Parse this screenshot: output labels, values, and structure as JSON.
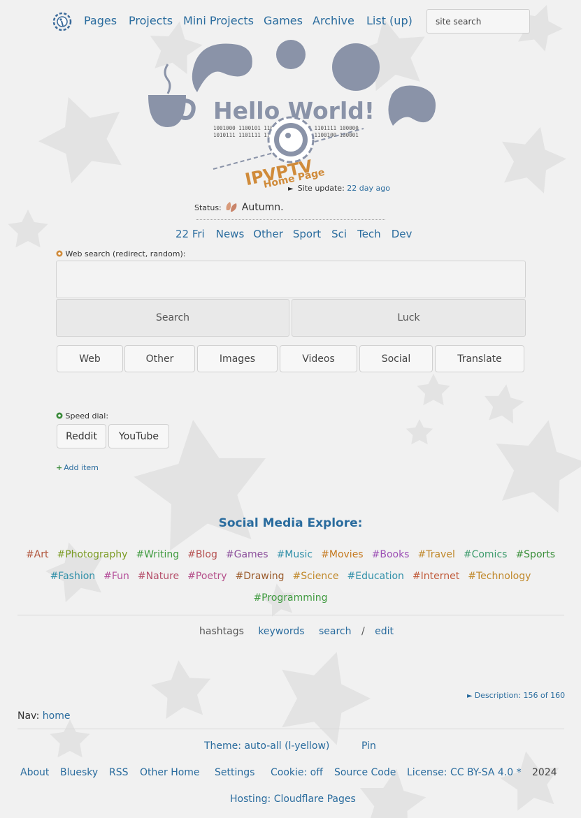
{
  "topnav": {
    "links": [
      "Pages",
      "Projects",
      "Mini Projects",
      "Games",
      "Archive",
      "List (up)"
    ],
    "search_placeholder": "site search"
  },
  "hero": {
    "title": "Hello World!",
    "binary_line1": "1001000 1100101 1101100 1101100 1101111 100000",
    "binary_line2": "1010111 1101111 1110010 1101100 1100100 100001",
    "brand": "IPVPTV",
    "subtitle": "Home Page"
  },
  "site_update": {
    "label": "Site update:",
    "value": "22 day ago"
  },
  "status": {
    "label": "Status:",
    "value": "Autumn."
  },
  "catnav": [
    "22 Fri",
    "News",
    "Other",
    "Sport",
    "Sci",
    "Tech",
    "Dev"
  ],
  "web_search": {
    "label": "Web search (redirect, random):",
    "search_button": "Search",
    "luck_button": "Luck",
    "engines": [
      "Web",
      "Other",
      "Images",
      "Videos",
      "Social",
      "Translate"
    ]
  },
  "speed_dial": {
    "label": "Speed dial:",
    "items": [
      "Reddit",
      "YouTube"
    ],
    "add_label": "Add item"
  },
  "social": {
    "title": "Social Media Explore:",
    "row1": [
      {
        "t": "#Art",
        "c": "#b0533a"
      },
      {
        "t": "#Photography",
        "c": "#7a9a22"
      },
      {
        "t": "#Writing",
        "c": "#3f9a3f"
      },
      {
        "t": "#Blog",
        "c": "#b54f4f"
      },
      {
        "t": "#Games",
        "c": "#8a4d9a"
      },
      {
        "t": "#Music",
        "c": "#2f8fa8"
      },
      {
        "t": "#Movies",
        "c": "#c5791f"
      },
      {
        "t": "#Books",
        "c": "#9c4fb5"
      },
      {
        "t": "#Travel",
        "c": "#c0882a"
      },
      {
        "t": "#Comics",
        "c": "#3a9a6a"
      },
      {
        "t": "#Sports",
        "c": "#3a8f3a"
      }
    ],
    "row2": [
      {
        "t": "#Fashion",
        "c": "#2f8fa8"
      },
      {
        "t": "#Fun",
        "c": "#b54f9a"
      },
      {
        "t": "#Nature",
        "c": "#b54f6a"
      },
      {
        "t": "#Poetry",
        "c": "#b5508a"
      },
      {
        "t": "#Drawing",
        "c": "#9a5a2a"
      },
      {
        "t": "#Science",
        "c": "#c0882a"
      },
      {
        "t": "#Education",
        "c": "#2f8fa8"
      },
      {
        "t": "#Internet",
        "c": "#c05a3a"
      },
      {
        "t": "#Technology",
        "c": "#c0882a"
      }
    ],
    "row3": [
      {
        "t": "#Programming",
        "c": "#3f9a3f"
      }
    ]
  },
  "subnav": {
    "hashtags": "hashtags",
    "keywords": "keywords",
    "search": "search",
    "slash": "/",
    "edit": "edit"
  },
  "description": "Description: 156 of 160",
  "nav": {
    "label": "Nav:",
    "home": "home"
  },
  "theme": {
    "theme": "Theme: auto-all (l-yellow)",
    "pin": "Pin"
  },
  "footer_links": [
    "About",
    "Bluesky",
    "RSS",
    "Other Home",
    "Settings",
    "Cookie: off",
    "Source Code",
    "License: CC BY-SA 4.0 *"
  ],
  "year": "2024",
  "hosting": "Hosting: Cloudflare Pages"
}
